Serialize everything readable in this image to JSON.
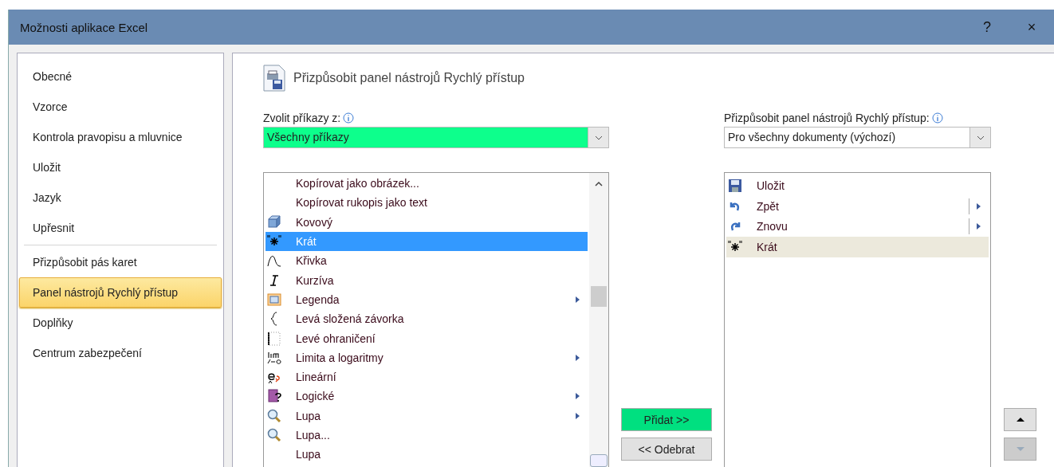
{
  "window": {
    "title": "Možnosti aplikace Excel",
    "help": "?",
    "close": "×"
  },
  "sidebar": {
    "items": [
      {
        "label": "Obecné",
        "selected": false,
        "divider_after": false
      },
      {
        "label": "Vzorce",
        "selected": false,
        "divider_after": false
      },
      {
        "label": "Kontrola pravopisu a mluvnice",
        "selected": false,
        "divider_after": false
      },
      {
        "label": "Uložit",
        "selected": false,
        "divider_after": false
      },
      {
        "label": "Jazyk",
        "selected": false,
        "divider_after": false
      },
      {
        "label": "Upřesnit",
        "selected": false,
        "divider_after": true
      },
      {
        "label": "Přizpůsobit pás karet",
        "selected": false,
        "divider_after": false
      },
      {
        "label": "Panel nástrojů Rychlý přístup",
        "selected": true,
        "divider_after": false
      },
      {
        "label": "Doplňky",
        "selected": false,
        "divider_after": false
      },
      {
        "label": "Centrum zabezpečení",
        "selected": false,
        "divider_after": false
      }
    ]
  },
  "heading": "Přizpůsobit panel nástrojů Rychlý přístup",
  "commands": {
    "label": "Zvolit příkazy z:",
    "dropdown": "Všechny příkazy",
    "items": [
      {
        "label": "Kopírovat jako obrázek...",
        "selected": false,
        "submenu": false
      },
      {
        "label": "Kopírovat rukopis jako text",
        "selected": false,
        "submenu": false
      },
      {
        "label": "Kovový",
        "selected": false,
        "submenu": false
      },
      {
        "label": "Krát",
        "selected": true,
        "submenu": false
      },
      {
        "label": "Křivka",
        "selected": false,
        "submenu": false
      },
      {
        "label": "Kurzíva",
        "selected": false,
        "submenu": false
      },
      {
        "label": "Legenda",
        "selected": false,
        "submenu": true
      },
      {
        "label": "Levá složená závorka",
        "selected": false,
        "submenu": false
      },
      {
        "label": "Levé ohraničení",
        "selected": false,
        "submenu": false
      },
      {
        "label": "Limita a logaritmy",
        "selected": false,
        "submenu": true
      },
      {
        "label": "Lineární",
        "selected": false,
        "submenu": false
      },
      {
        "label": "Logické",
        "selected": false,
        "submenu": true
      },
      {
        "label": "Lupa",
        "selected": false,
        "submenu": true
      },
      {
        "label": "Lupa...",
        "selected": false,
        "submenu": false
      },
      {
        "label": "Lupa",
        "selected": false,
        "submenu": false
      }
    ]
  },
  "add_button": "Přidat >>",
  "remove_button": "<< Odebrat",
  "toolbar": {
    "label": "Přizpůsobit panel nástrojů Rychlý přístup:",
    "dropdown": "Pro všechny dokumenty (výchozí)",
    "items": [
      {
        "label": "Uložit",
        "selected": false,
        "submenu": false
      },
      {
        "label": "Zpět",
        "selected": false,
        "submenu": true
      },
      {
        "label": "Znovu",
        "selected": false,
        "submenu": true
      },
      {
        "label": "Krát",
        "selected": true,
        "submenu": false
      }
    ]
  },
  "move_up": {
    "disabled": false
  },
  "move_down": {
    "disabled": true
  }
}
